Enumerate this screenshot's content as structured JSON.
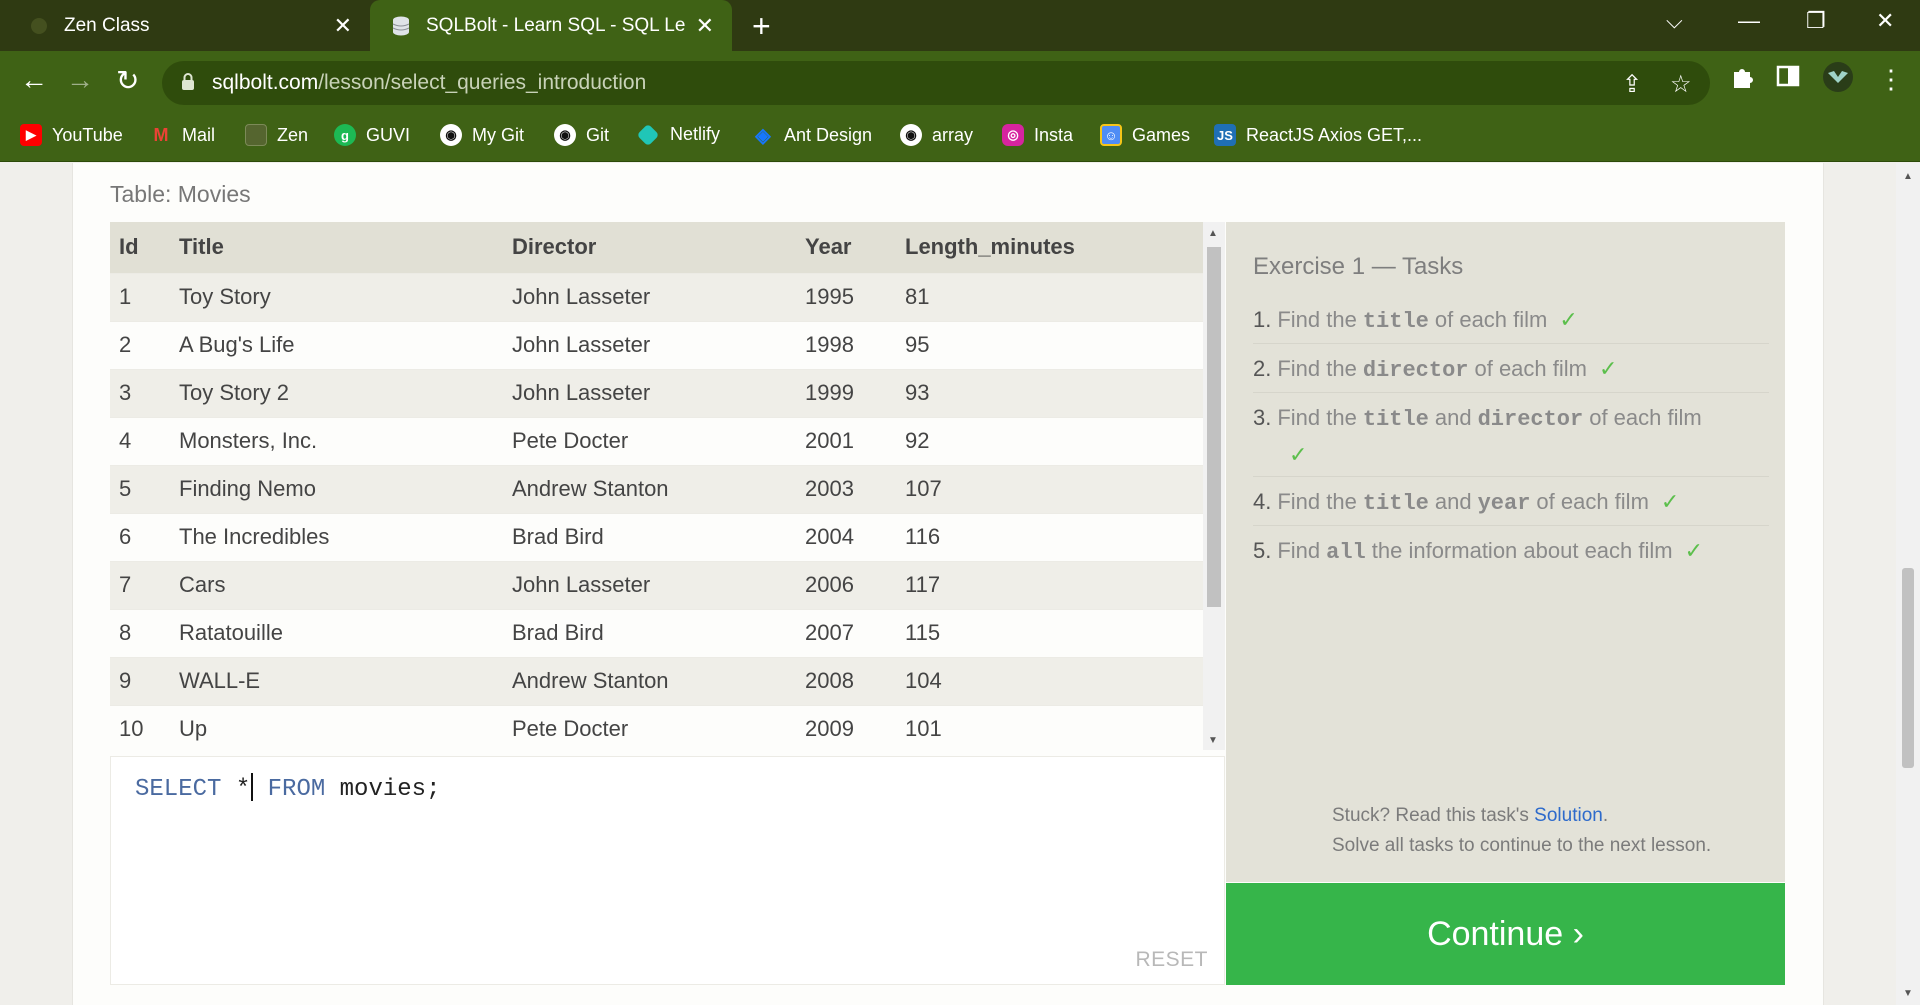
{
  "browser": {
    "tabs": [
      {
        "title": "Zen Class",
        "active": false
      },
      {
        "title": "SQLBolt - Learn SQL - SQL Lesson",
        "active": true
      }
    ],
    "url": {
      "host": "sqlbolt.com",
      "path": "/lesson/select_queries_introduction"
    },
    "bookmarks": [
      {
        "label": "YouTube",
        "icon": "youtube-icon",
        "color": "#ff0000"
      },
      {
        "label": "Mail",
        "icon": "gmail-icon",
        "color": "#ea4335"
      },
      {
        "label": "Zen",
        "icon": "zen-icon",
        "color": "#5b6b3a"
      },
      {
        "label": "GUVI",
        "icon": "guvi-icon",
        "color": "#1db954"
      },
      {
        "label": "My Git",
        "icon": "github-icon",
        "color": "#111111"
      },
      {
        "label": "Git",
        "icon": "github-icon",
        "color": "#111111"
      },
      {
        "label": "Netlify",
        "icon": "netlify-icon",
        "color": "#20c6b7"
      },
      {
        "label": "Ant Design",
        "icon": "ant-design-icon",
        "color": "#1677ff"
      },
      {
        "label": "array",
        "icon": "github-icon",
        "color": "#111111"
      },
      {
        "label": "Insta",
        "icon": "instagram-icon",
        "color": "#d6249f"
      },
      {
        "label": "Games",
        "icon": "games-icon",
        "color": "#4f8df5"
      },
      {
        "label": "ReactJS Axios GET,...",
        "icon": "js-icon",
        "color": "#1f6fb5"
      }
    ]
  },
  "lesson": {
    "table_label": "Table: Movies",
    "table": {
      "columns": [
        "Id",
        "Title",
        "Director",
        "Year",
        "Length_minutes"
      ],
      "rows": [
        [
          "1",
          "Toy Story",
          "John Lasseter",
          "1995",
          "81"
        ],
        [
          "2",
          "A Bug's Life",
          "John Lasseter",
          "1998",
          "95"
        ],
        [
          "3",
          "Toy Story 2",
          "John Lasseter",
          "1999",
          "93"
        ],
        [
          "4",
          "Monsters, Inc.",
          "Pete Docter",
          "2001",
          "92"
        ],
        [
          "5",
          "Finding Nemo",
          "Andrew Stanton",
          "2003",
          "107"
        ],
        [
          "6",
          "The Incredibles",
          "Brad Bird",
          "2004",
          "116"
        ],
        [
          "7",
          "Cars",
          "John Lasseter",
          "2006",
          "117"
        ],
        [
          "8",
          "Ratatouille",
          "Brad Bird",
          "2007",
          "115"
        ],
        [
          "9",
          "WALL-E",
          "Andrew Stanton",
          "2008",
          "104"
        ],
        [
          "10",
          "Up",
          "Pete Docter",
          "2009",
          "101"
        ]
      ]
    },
    "editor": {
      "query_keyword1": "SELECT",
      "query_star": "*",
      "query_keyword2": "FROM",
      "query_rest": "movies;",
      "reset_label": "RESET"
    },
    "tasks": {
      "title": "Exercise 1 — Tasks",
      "items": [
        {
          "num": "1.",
          "pre": "Find the",
          "code1": "title",
          "mid": "",
          "code2": "",
          "post": "of each film",
          "check": "✓"
        },
        {
          "num": "2.",
          "pre": "Find the",
          "code1": "director",
          "mid": "",
          "code2": "",
          "post": "of each film",
          "check": "✓"
        },
        {
          "num": "3.",
          "pre": "Find the",
          "code1": "title",
          "mid": "and",
          "code2": "director",
          "post": "of each film",
          "check": "✓"
        },
        {
          "num": "4.",
          "pre": "Find the",
          "code1": "title",
          "mid": "and",
          "code2": "year",
          "post": "of each film",
          "check": "✓"
        },
        {
          "num": "5.",
          "pre": "Find",
          "code1": "all",
          "mid": "",
          "code2": "",
          "post": "the information about each film",
          "check": "✓"
        }
      ]
    },
    "hint": {
      "line1_pre": "Stuck? Read this task's ",
      "solution_link": "Solution",
      "line1_post": ".",
      "line2": "Solve all tasks to continue to the next lesson."
    },
    "continue_label": "Continue ›"
  }
}
